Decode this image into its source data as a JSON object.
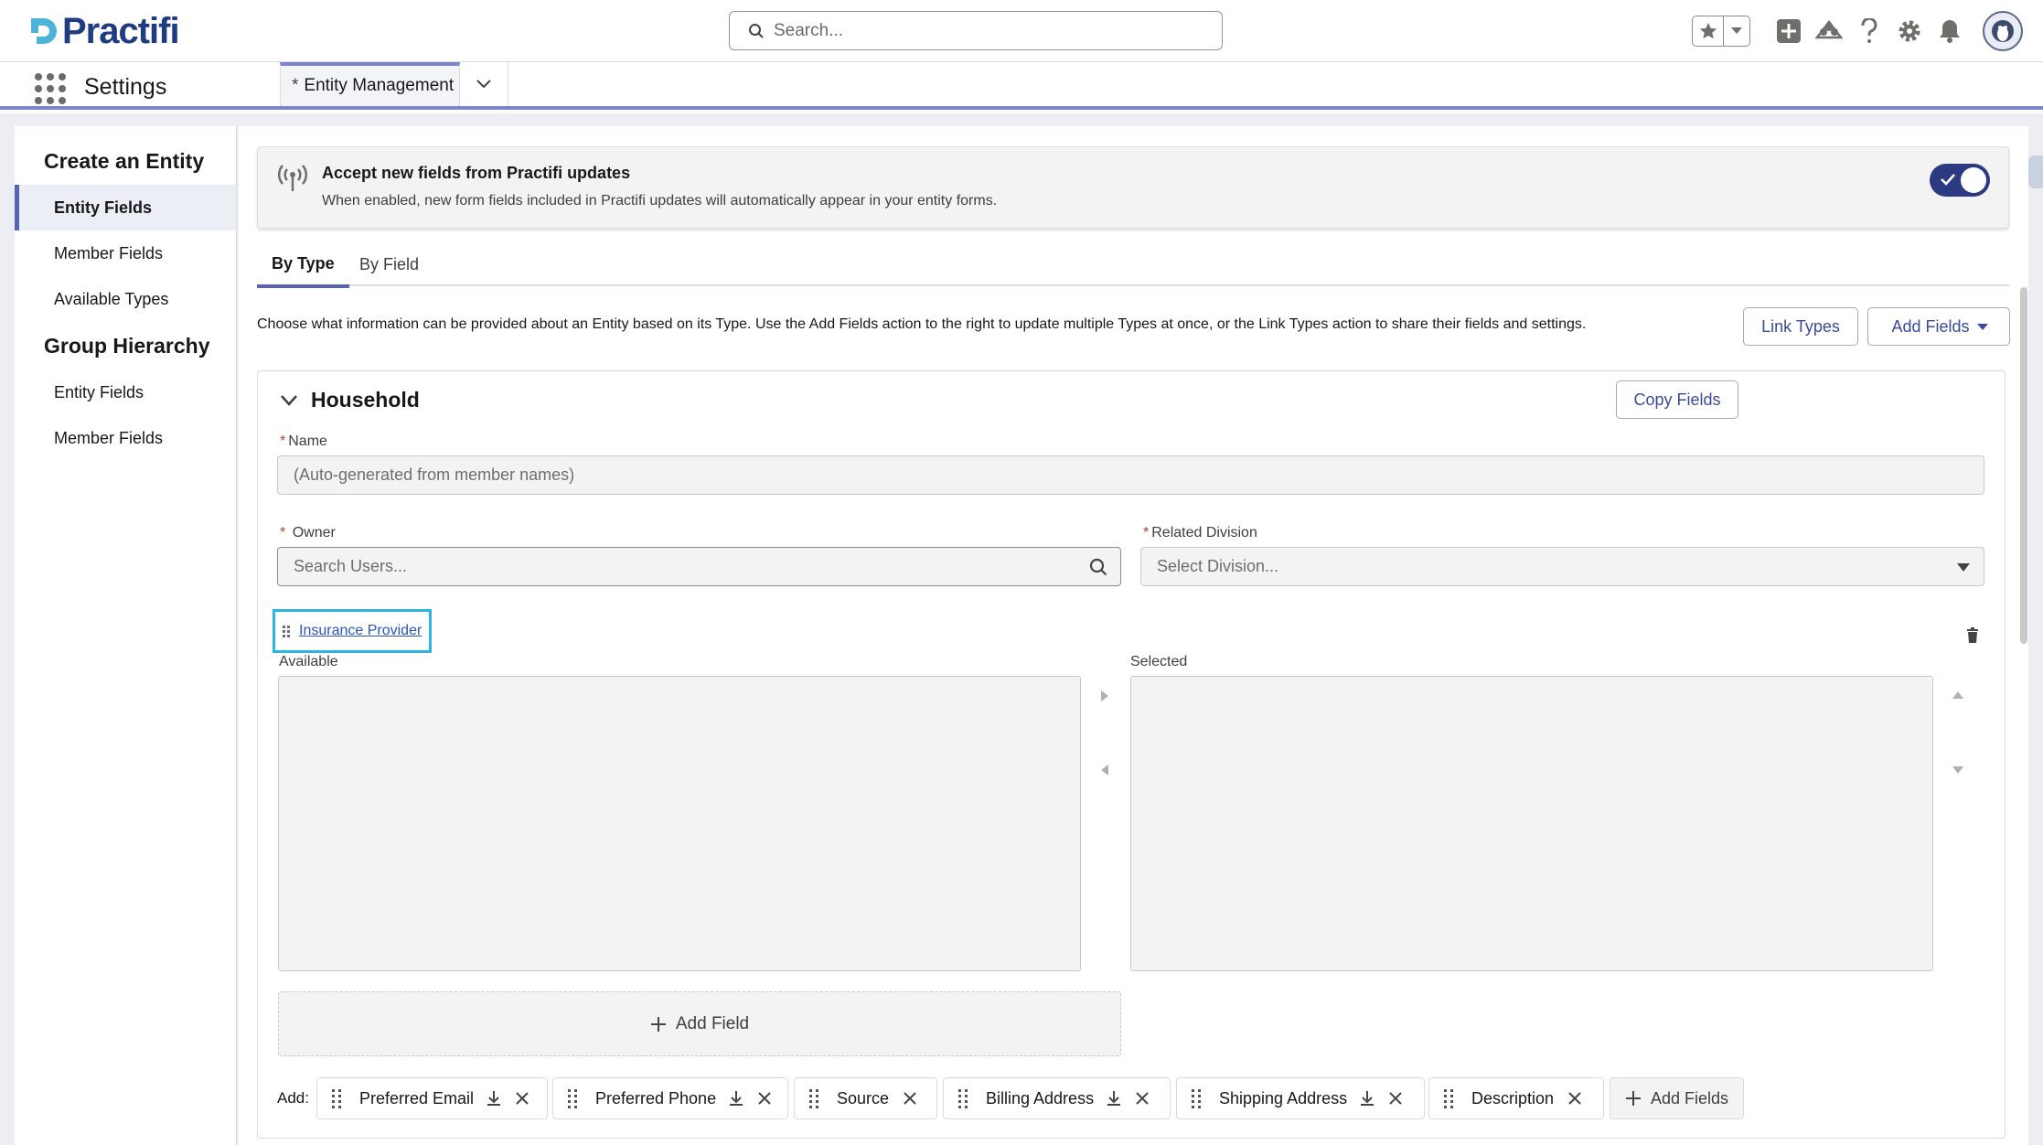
{
  "header": {
    "brand": "Practifi",
    "search_placeholder": "Search..."
  },
  "nav": {
    "app_name": "Settings",
    "active_tab_marker": "*",
    "active_tab": "Entity Management"
  },
  "sidebar": {
    "sections": [
      {
        "title": "Create an Entity",
        "items": [
          "Entity Fields",
          "Member Fields",
          "Available Types"
        ]
      },
      {
        "title": "Group Hierarchy",
        "items": [
          "Entity Fields",
          "Member Fields"
        ]
      }
    ],
    "active_item": "Entity Fields"
  },
  "banner": {
    "title": "Accept new fields from Practifi updates",
    "description": "When enabled, new form fields included in Practifi updates will automatically appear in your entity forms.",
    "toggle_on": true
  },
  "tabs": {
    "by_type": "By Type",
    "by_field": "By Field",
    "active": "By Type"
  },
  "description": "Choose what information can be provided about an Entity based on its Type. Use the Add Fields action to the right to update multiple Types at once, or the Link Types action to share their fields and settings.",
  "buttons": {
    "link_types": "Link Types",
    "add_fields": "Add Fields",
    "copy_fields": "Copy Fields"
  },
  "household": {
    "title": "Household",
    "name_label": "Name",
    "name_placeholder": "(Auto-generated from member names)",
    "owner_label": "Owner",
    "owner_placeholder": "Search Users...",
    "division_label": "Related Division",
    "division_placeholder": "Select Division...",
    "required_marker": "*",
    "insurance_link": "Insurance Provider",
    "available_label": "Available",
    "selected_label": "Selected",
    "add_field_label": "Add Field"
  },
  "add_bar": {
    "label": "Add:",
    "chips": [
      {
        "label": "Preferred Email",
        "download": true
      },
      {
        "label": "Preferred Phone",
        "download": true
      },
      {
        "label": "Source",
        "download": false
      },
      {
        "label": "Billing Address",
        "download": true
      },
      {
        "label": "Shipping Address",
        "download": true
      },
      {
        "label": "Description",
        "download": false
      }
    ],
    "add_fields": "Add Fields"
  },
  "icons": [
    "search-icon",
    "star-icon",
    "chevron-down-icon",
    "plus-square-icon",
    "cloud-icon",
    "help-icon",
    "gear-icon",
    "bell-icon",
    "antenna-icon",
    "check-icon",
    "trash-icon",
    "grip-icon",
    "download-icon",
    "close-icon"
  ],
  "colors": {
    "brand": "#1f3b82",
    "accent": "#5763b4",
    "toggle": "#2b3b82",
    "highlight": "#2bb5e0",
    "link": "#2b54b5"
  }
}
